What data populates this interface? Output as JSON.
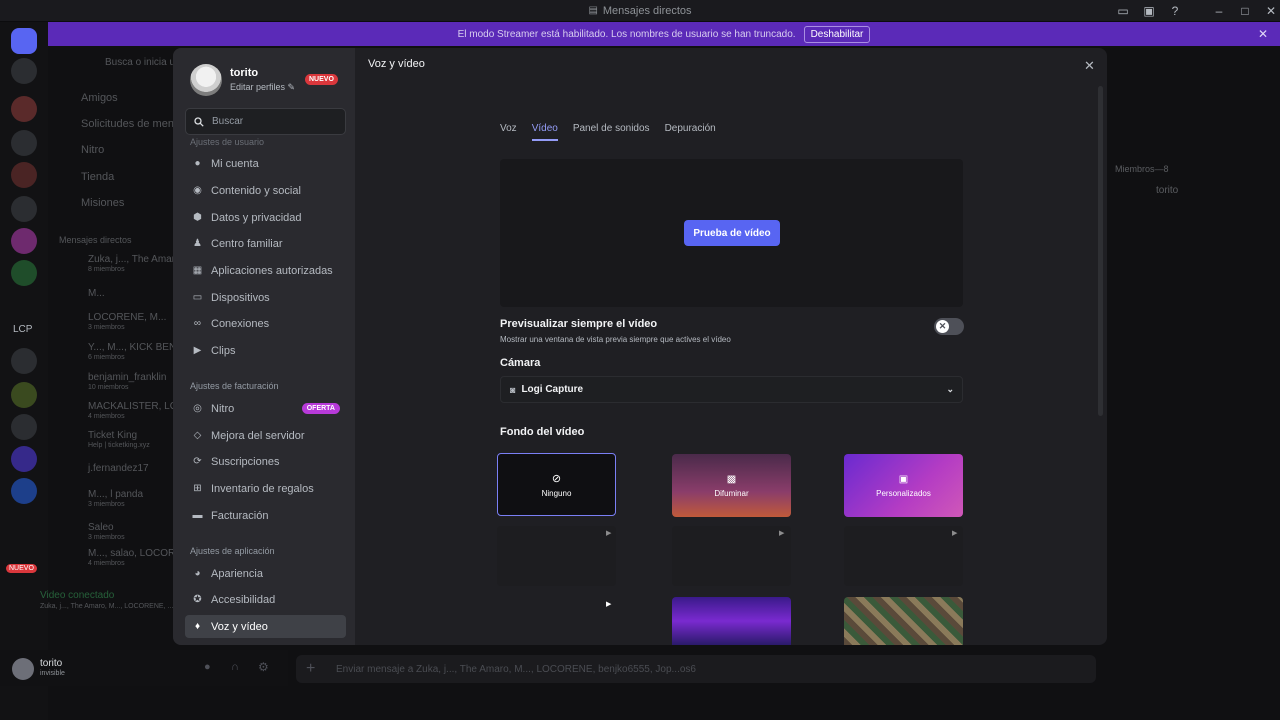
{
  "window": {
    "title": "Mensajes directos"
  },
  "banner": {
    "text": "El modo Streamer está habilitado. Los nombres de usuario se han truncado.",
    "button": "Deshabilitar"
  },
  "background": {
    "search_hint": "Busca o inicia una",
    "nav": [
      "Amigos",
      "Solicitudes de mensa",
      "Nitro",
      "Tienda",
      "Misiones"
    ],
    "dm_header": "Mensajes directos",
    "dms": [
      {
        "name": "Zuka, j..., The Amar...",
        "sub": "8 miembros"
      },
      {
        "name": "M...",
        "sub": ""
      },
      {
        "name": "LOCORENE, M...",
        "sub": "3 miembros"
      },
      {
        "name": "Y..., M..., KICK BEN",
        "sub": "6 miembros"
      },
      {
        "name": "benjamin_franklin",
        "sub": "10 miembros"
      },
      {
        "name": "MACKALISTER, LO",
        "sub": "4 miembros"
      },
      {
        "name": "Ticket King",
        "sub": "Help | ticketking.xyz"
      },
      {
        "name": "j.fernandez17",
        "sub": ""
      },
      {
        "name": "M..., l panda",
        "sub": "3 miembros"
      },
      {
        "name": "Saleo",
        "sub": "3 miembros"
      },
      {
        "name": "M..., salao, LOCOR",
        "sub": "4 miembros"
      }
    ],
    "voice_status": "Video conectado",
    "voice_sub": "Zuka, j..., The Amaro, M..., LOCORENE, ...",
    "user": {
      "name": "torito",
      "status": "invisible"
    },
    "message_placeholder": "Enviar mensaje a Zuka, j..., The Amaro, M..., LOCORENE, benjko6555, Jop...os6",
    "members_header": "Miembros—8",
    "members": [
      "torito"
    ],
    "server_labels": [
      "LCP",
      "NUEVO"
    ]
  },
  "modal": {
    "profile": {
      "name": "torito",
      "edit": "Editar perfiles",
      "badge": "NUEVO"
    },
    "search_placeholder": "Buscar",
    "user_section": "Ajustes de usuario",
    "user_items": [
      {
        "label": "Mi cuenta",
        "icon": "user-icon"
      },
      {
        "label": "Contenido y social",
        "icon": "content-icon"
      },
      {
        "label": "Datos y privacidad",
        "icon": "shield-icon"
      },
      {
        "label": "Centro familiar",
        "icon": "family-icon"
      },
      {
        "label": "Aplicaciones autorizadas",
        "icon": "apps-icon"
      },
      {
        "label": "Dispositivos",
        "icon": "devices-icon"
      },
      {
        "label": "Conexiones",
        "icon": "link-icon"
      },
      {
        "label": "Clips",
        "icon": "clips-icon"
      }
    ],
    "billing_section": "Ajustes de facturación",
    "billing_items": [
      {
        "label": "Nitro",
        "icon": "nitro-icon",
        "badge": "OFERTA"
      },
      {
        "label": "Mejora del servidor",
        "icon": "boost-icon"
      },
      {
        "label": "Suscripciones",
        "icon": "subscriptions-icon"
      },
      {
        "label": "Inventario de regalos",
        "icon": "gift-icon"
      },
      {
        "label": "Facturación",
        "icon": "billing-icon"
      }
    ],
    "app_section": "Ajustes de aplicación",
    "app_items": [
      {
        "label": "Apariencia",
        "icon": "palette-icon"
      },
      {
        "label": "Accesibilidad",
        "icon": "accessibility-icon"
      },
      {
        "label": "Voz y vídeo",
        "icon": "microphone-icon"
      }
    ],
    "page_title": "Voz y vídeo",
    "tabs": [
      "Voz",
      "Vídeo",
      "Panel de sonidos",
      "Depuración"
    ],
    "selected_tab": "Vídeo",
    "test_video_button": "Prueba de vídeo",
    "always_preview": {
      "label": "Previsualizar siempre el vídeo",
      "description": "Mostrar una ventana de vista previa siempre que actives el vídeo",
      "enabled": false
    },
    "camera": {
      "label": "Cámara",
      "selected": "Logi Capture"
    },
    "background": {
      "label": "Fondo del vídeo",
      "options": [
        "Ninguno",
        "Difuminar",
        "Personalizados"
      ],
      "selected": "Ninguno"
    },
    "colors": {
      "accent": "#5865f2",
      "tab_selected": "#949cf7",
      "nuevo": "#da373c",
      "oferta": "#b73ad9",
      "banner": "#5b2ab8"
    }
  }
}
